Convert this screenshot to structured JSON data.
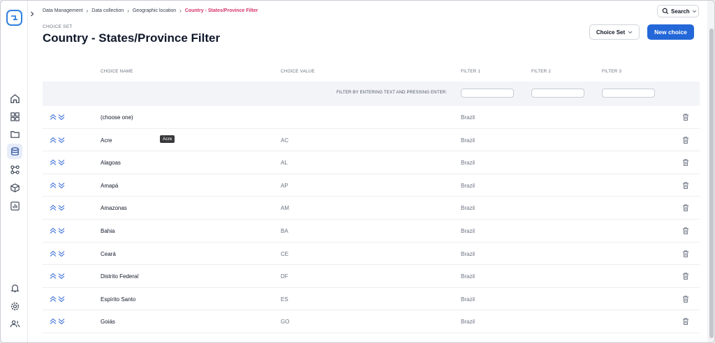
{
  "colors": {
    "accent": "#2367d8",
    "breadcrumb_current": "#d6336c",
    "logo": "#2f7fe0"
  },
  "rail": {
    "top_icons": [
      "home-icon",
      "grid-icon",
      "folder-icon",
      "database-icon",
      "workflow-icon",
      "cube-icon",
      "chart-icon"
    ],
    "bottom_icons": [
      "bell-icon",
      "gear-icon",
      "users-icon"
    ],
    "active": "database-icon"
  },
  "breadcrumb": [
    "Data Management",
    "Data collection",
    "Geographic location",
    "Country - States/Province Filter"
  ],
  "search": {
    "label": "Search"
  },
  "header": {
    "eyebrow": "CHOICE SET",
    "title": "Country - States/Province Filter"
  },
  "actions": {
    "choice_set_label": "Choice Set",
    "new_choice_label": "New choice"
  },
  "table": {
    "columns": {
      "choice_name": "CHOICE NAME",
      "choice_value": "CHOICE VALUE",
      "filter1": "FILTER 1",
      "filter2": "FILTER 2",
      "filter3": "FILTER 3"
    },
    "filter_hint": "FILTER BY ENTERING TEXT AND PRESSING ENTER:",
    "rows": [
      {
        "name": "(choose one)",
        "value": "",
        "filter1": "Brazil"
      },
      {
        "name": "Acre",
        "value": "AC",
        "filter1": "Brazil"
      },
      {
        "name": "Alagoas",
        "value": "AL",
        "filter1": "Brazil"
      },
      {
        "name": "Amapá",
        "value": "AP",
        "filter1": "Brazil"
      },
      {
        "name": "Amazonas",
        "value": "AM",
        "filter1": "Brazil"
      },
      {
        "name": "Bahia",
        "value": "BA",
        "filter1": "Brazil"
      },
      {
        "name": "Ceará",
        "value": "CE",
        "filter1": "Brazil"
      },
      {
        "name": "Distrito Federal",
        "value": "DF",
        "filter1": "Brazil"
      },
      {
        "name": "Espírito Santo",
        "value": "ES",
        "filter1": "Brazil"
      },
      {
        "name": "Goiás",
        "value": "GO",
        "filter1": "Brazil"
      }
    ]
  },
  "tooltip": {
    "text": "Acre"
  }
}
